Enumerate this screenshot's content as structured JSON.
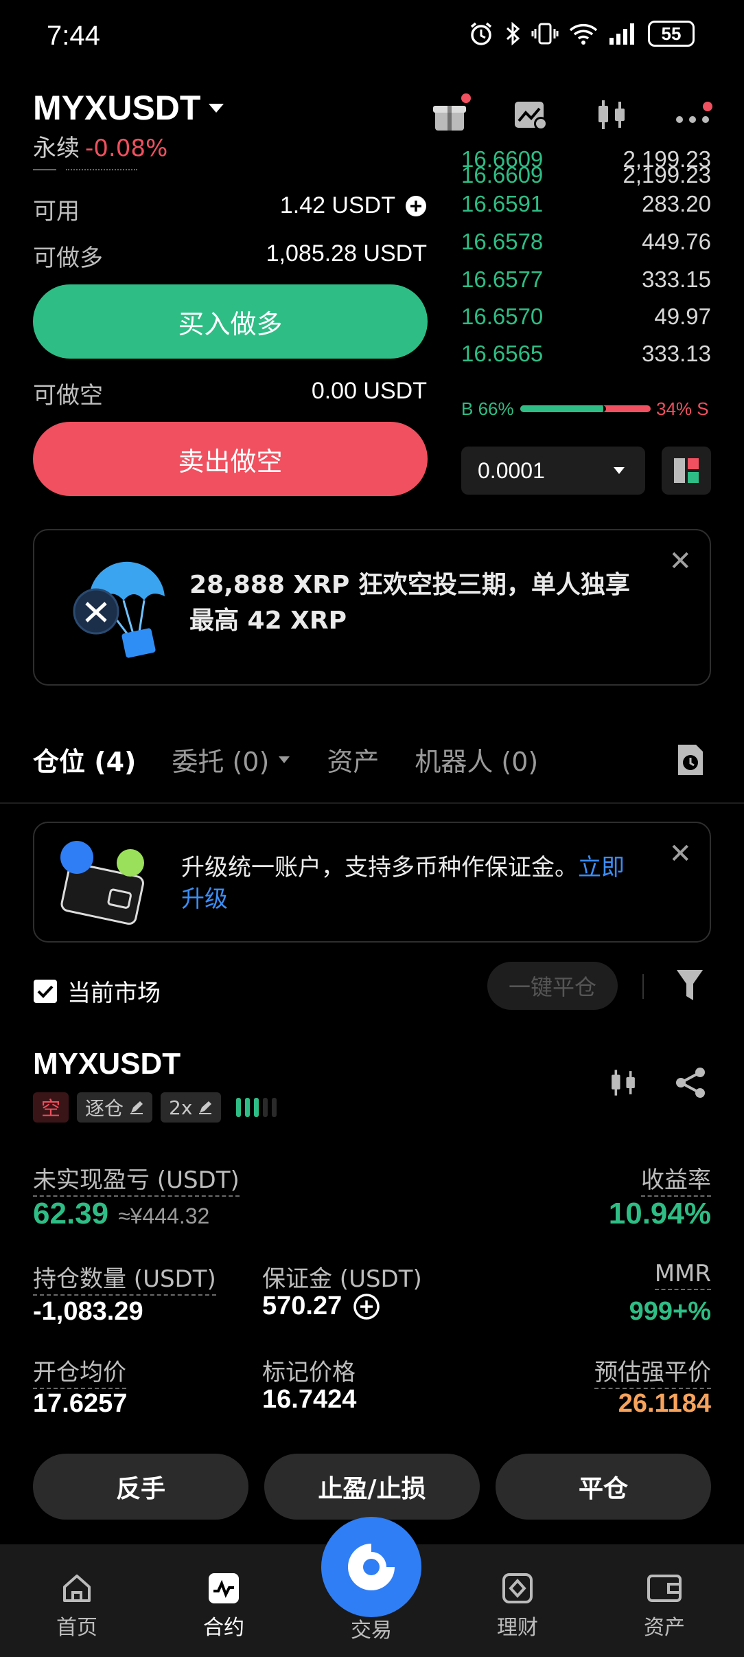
{
  "status_bar": {
    "time": "7:44",
    "battery": "55"
  },
  "header": {
    "pair": "MYXUSDT",
    "contract_type": "永续",
    "change": "-0.08%"
  },
  "trade_panel": {
    "available_label": "可用",
    "available_value": "1.42 USDT",
    "can_long_label": "可做多",
    "can_long_value": "1,085.28 USDT",
    "buy_label": "买入做多",
    "can_short_label": "可做空",
    "can_short_value": "0.00 USDT",
    "sell_label": "卖出做空"
  },
  "order_book": {
    "rows": [
      {
        "price": "16.6609",
        "qty": "2,199.23"
      },
      {
        "price": "16.6591",
        "qty": "283.20"
      },
      {
        "price": "16.6578",
        "qty": "449.76"
      },
      {
        "price": "16.6577",
        "qty": "333.15"
      },
      {
        "price": "16.6570",
        "qty": "49.97"
      },
      {
        "price": "16.6565",
        "qty": "333.13"
      }
    ],
    "buy_ratio_label": "B 66%",
    "sell_ratio_label": "34% S",
    "buy_ratio": 0.66,
    "precision": "0.0001",
    "buy_color": "#2ebd85",
    "sell_color": "#f0505f"
  },
  "promo_airdrop": {
    "text_line1": "28,888 XRP 狂欢空投三期，单人独享",
    "text_line2": "最高 42 XRP"
  },
  "tabs": {
    "positions": "仓位 (4)",
    "orders": "委托 (0)",
    "assets": "资产",
    "bots": "机器人 (0)"
  },
  "promo_upgrade": {
    "text": "升级统一账户，支持多币种作保证金。",
    "link1": "立即",
    "link2": "升级"
  },
  "filter_bar": {
    "current_market_label": "当前市场",
    "close_all_label": "一键平仓"
  },
  "position": {
    "pair": "MYXUSDT",
    "side_tag": "空",
    "margin_mode": "逐仓",
    "leverage": "2x",
    "upnl_label": "未实现盈亏 (USDT)",
    "upnl_value": "62.39",
    "upnl_cny": "≈¥444.32",
    "roi_label": "收益率",
    "roi_value": "10.94%",
    "size_label": "持仓数量 (USDT)",
    "size_value": "-1,083.29",
    "margin_label": "保证金 (USDT)",
    "margin_value": "570.27",
    "mmr_label": "MMR",
    "mmr_value": "999+%",
    "entry_label": "开仓均价",
    "entry_value": "17.6257",
    "mark_label": "标记价格",
    "mark_value": "16.7424",
    "liq_label": "预估强平价",
    "liq_value": "26.1184",
    "reverse_label": "反手",
    "tpsl_label": "止盈/止损",
    "close_label": "平仓"
  },
  "bottom_nav": {
    "home": "首页",
    "futures": "合约",
    "trade": "交易",
    "earn": "理财",
    "assets": "资产"
  }
}
